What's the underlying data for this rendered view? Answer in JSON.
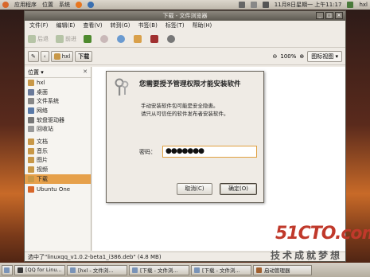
{
  "top_panel": {
    "apps": "应用程序",
    "places": "位置",
    "system": "系统",
    "datetime": "11月8日星期一 上午11:17",
    "user": "hxl"
  },
  "window": {
    "title": "下载 - 文件浏览器",
    "menu": [
      "文件(F)",
      "编辑(E)",
      "查看(V)",
      "转到(G)",
      "书签(B)",
      "标签(T)",
      "帮助(H)"
    ],
    "toolbar": {
      "back": "后退",
      "forward": "前进"
    },
    "location": {
      "crumb_home": "hxl",
      "crumb_current": "下载",
      "zoom": "100%",
      "view": "图标视图"
    },
    "sidebar": {
      "title": "位置",
      "items": [
        "hxl",
        "桌面",
        "文件系统",
        "网络",
        "软盘驱动器",
        "回收站",
        "文档",
        "音乐",
        "图片",
        "视频",
        "下载",
        "Ubuntu One"
      ],
      "selected_index": 10
    },
    "status": "选中了\"linuxqq_v1.0.2-beta1_i386.deb\" (4.8 MB)"
  },
  "dialog": {
    "title": "您需要授予管理权限才能安装软件",
    "message_line1": "手动安装软件包可能是安全隐患。",
    "message_line2": "请只从可信任的软件发布者安装软件。",
    "password_label": "密码：",
    "password_value": "●●●●●●●",
    "cancel": "取消(C)",
    "ok": "确定(O)"
  },
  "taskbar": [
    "[QQ for Linu...",
    "[hxl - 文件浏...",
    "[下载 - 文件浏...",
    "[下载 - 文件浏...",
    "启动管理器"
  ],
  "watermark": {
    "brand": "51CTO.com",
    "tagline": "技术成就梦想"
  },
  "colors": {
    "accent": "#e6a04a",
    "titlebar": "#5c5850",
    "watermark": "#c0392b"
  }
}
